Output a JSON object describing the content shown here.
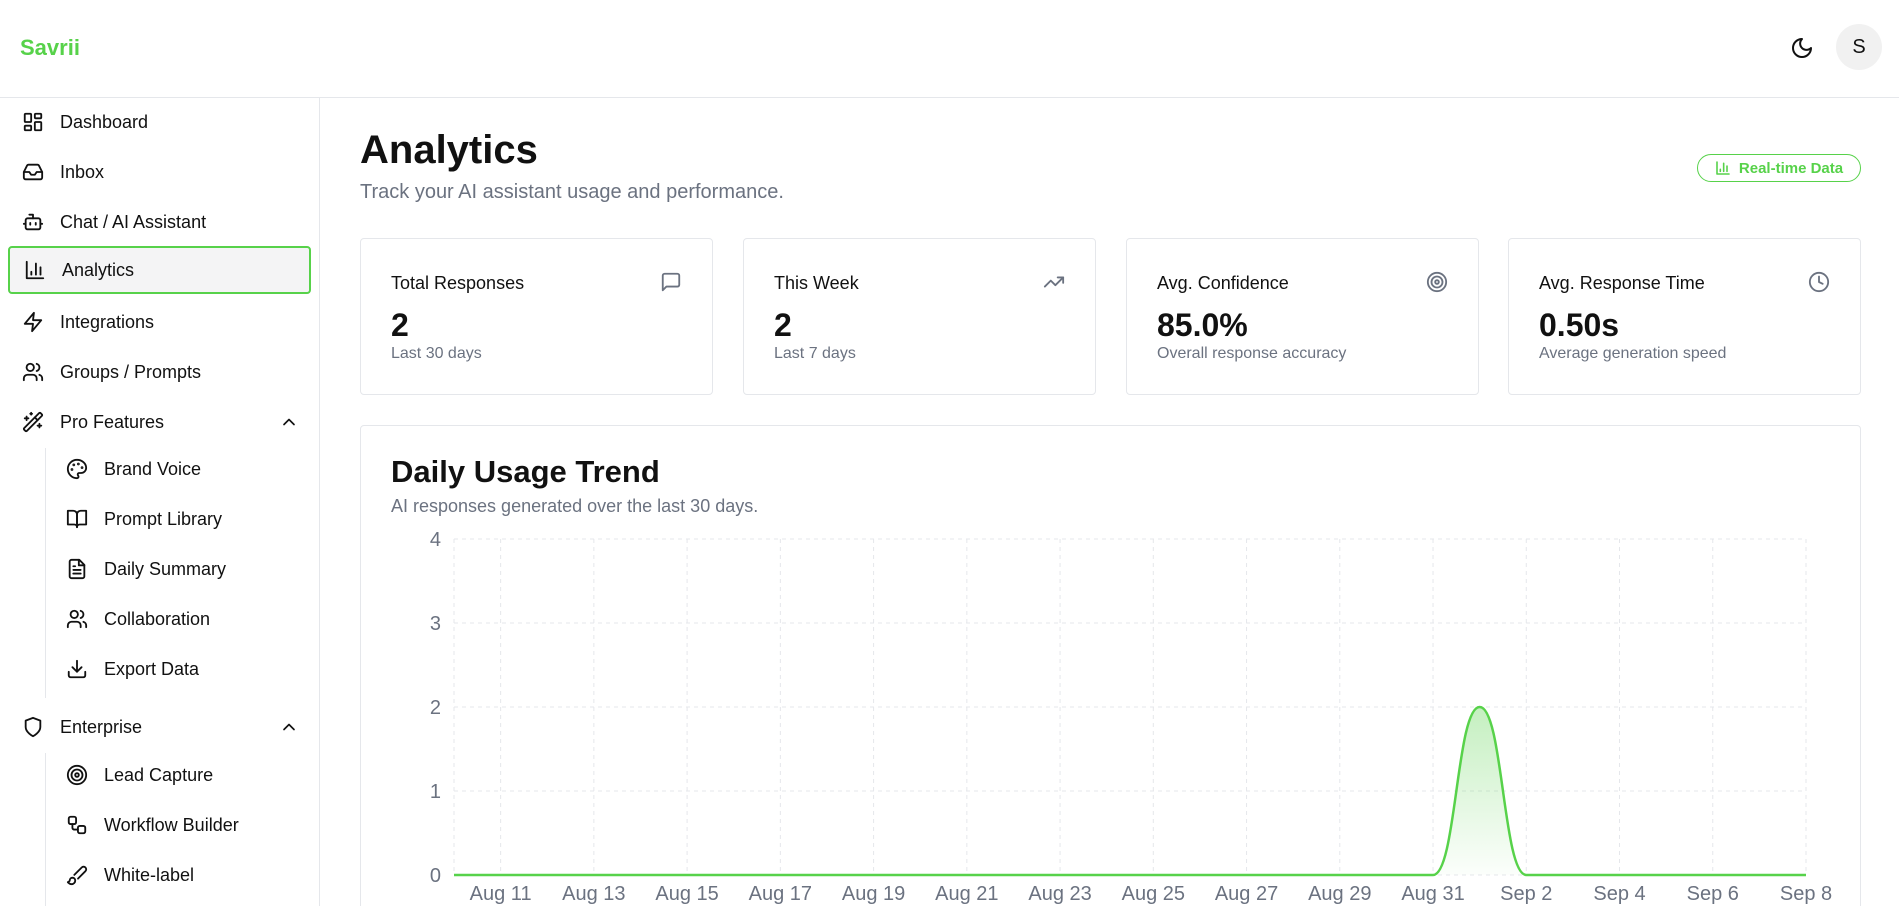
{
  "app": {
    "brand": "Savrii",
    "user_initial": "S"
  },
  "sidebar": {
    "items": [
      {
        "label": "Dashboard",
        "icon": "layout-dashboard-icon"
      },
      {
        "label": "Inbox",
        "icon": "inbox-icon"
      },
      {
        "label": "Chat / AI Assistant",
        "icon": "bot-icon"
      },
      {
        "label": "Analytics",
        "icon": "bar-chart-icon",
        "active": true
      },
      {
        "label": "Integrations",
        "icon": "zap-icon"
      },
      {
        "label": "Groups / Prompts",
        "icon": "users-icon"
      }
    ],
    "pro": {
      "label": "Pro Features",
      "icon": "wand-icon",
      "expanded": true,
      "items": [
        {
          "label": "Brand Voice",
          "icon": "palette-icon"
        },
        {
          "label": "Prompt Library",
          "icon": "book-open-icon"
        },
        {
          "label": "Daily Summary",
          "icon": "file-text-icon"
        },
        {
          "label": "Collaboration",
          "icon": "users-icon"
        },
        {
          "label": "Export Data",
          "icon": "download-icon"
        }
      ]
    },
    "enterprise": {
      "label": "Enterprise",
      "icon": "shield-icon",
      "expanded": true,
      "items": [
        {
          "label": "Lead Capture",
          "icon": "target-icon"
        },
        {
          "label": "Workflow Builder",
          "icon": "workflow-icon"
        },
        {
          "label": "White-label",
          "icon": "brush-icon"
        }
      ]
    }
  },
  "page": {
    "title": "Analytics",
    "subtitle": "Track your AI assistant usage and performance.",
    "badge": "Real-time Data"
  },
  "cards": [
    {
      "title": "Total Responses",
      "value": "2",
      "sub": "Last 30 days",
      "icon": "message-square-icon"
    },
    {
      "title": "This Week",
      "value": "2",
      "sub": "Last 7 days",
      "icon": "trending-up-icon"
    },
    {
      "title": "Avg. Confidence",
      "value": "85.0%",
      "sub": "Overall response accuracy",
      "icon": "target-icon"
    },
    {
      "title": "Avg. Response Time",
      "value": "0.50s",
      "sub": "Average generation speed",
      "icon": "clock-icon"
    }
  ],
  "usage": {
    "title": "Daily Usage Trend",
    "subtitle": "AI responses generated over the last 30 days."
  },
  "colors": {
    "accent": "#57d24a",
    "muted": "#6b7280",
    "border": "#e5e7eb"
  },
  "chart_data": {
    "type": "area",
    "title": "Daily Usage Trend",
    "x": [
      "Aug 10",
      "Aug 11",
      "Aug 12",
      "Aug 13",
      "Aug 14",
      "Aug 15",
      "Aug 16",
      "Aug 17",
      "Aug 18",
      "Aug 19",
      "Aug 20",
      "Aug 21",
      "Aug 22",
      "Aug 23",
      "Aug 24",
      "Aug 25",
      "Aug 26",
      "Aug 27",
      "Aug 28",
      "Aug 29",
      "Aug 30",
      "Aug 31",
      "Sep 1",
      "Sep 2",
      "Sep 3",
      "Sep 4",
      "Sep 5",
      "Sep 6",
      "Sep 7",
      "Sep 8"
    ],
    "values": [
      0,
      0,
      0,
      0,
      0,
      0,
      0,
      0,
      0,
      0,
      0,
      0,
      0,
      0,
      0,
      0,
      0,
      0,
      0,
      0,
      0,
      0,
      2,
      0,
      0,
      0,
      0,
      0,
      0,
      0
    ],
    "x_tick_labels": [
      "Aug 11",
      "Aug 13",
      "Aug 15",
      "Aug 17",
      "Aug 19",
      "Aug 21",
      "Aug 23",
      "Aug 25",
      "Aug 27",
      "Aug 29",
      "Aug 31",
      "Sep 2",
      "Sep 4",
      "Sep 6",
      "Sep 8"
    ],
    "y_ticks": [
      0,
      1,
      2,
      3,
      4
    ],
    "ylim": [
      0,
      4
    ],
    "grid": true,
    "color": "#57d24a"
  }
}
